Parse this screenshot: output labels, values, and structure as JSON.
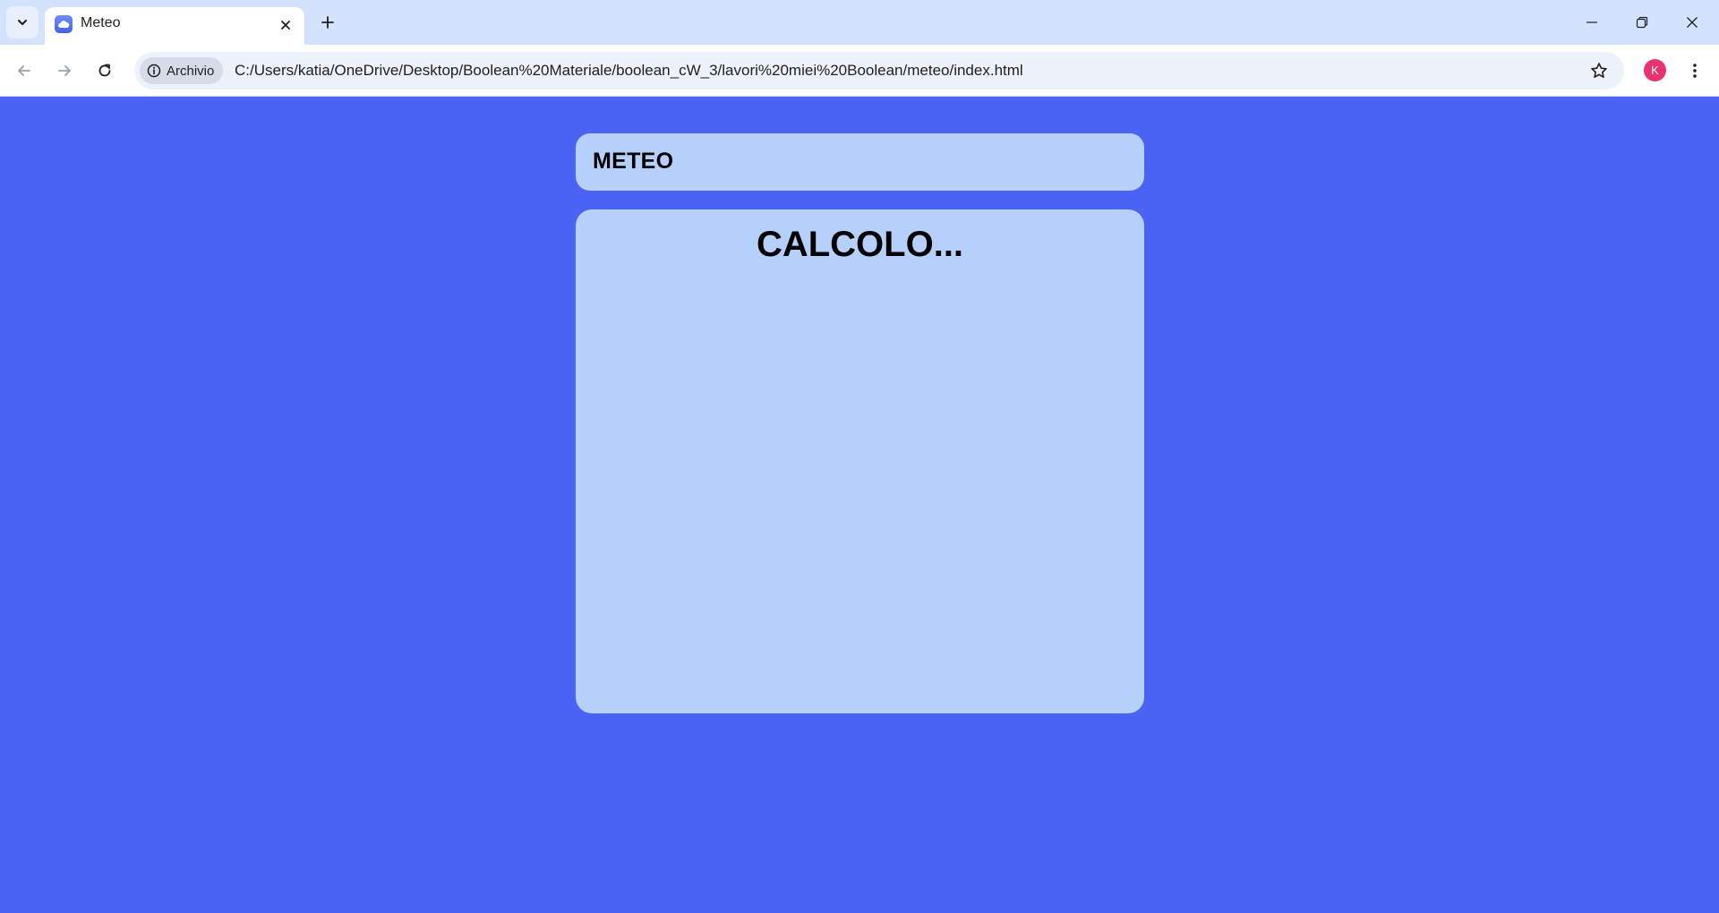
{
  "browser": {
    "tab": {
      "title": "Meteo",
      "favicon": "cloud-icon"
    },
    "address": {
      "security_label": "Archivio",
      "url": "C:/Users/katia/OneDrive/Desktop/Boolean%20Materiale/boolean_cW_3/lavori%20miei%20Boolean/meteo/index.html"
    },
    "profile_initial": "K",
    "colors": {
      "tabstrip": "#d3e3fd",
      "omnibox": "#edf2fa",
      "avatar": "#e8336f"
    }
  },
  "page": {
    "header_title": "METEO",
    "status": "CALCOLO...",
    "colors": {
      "background": "#4a63f2",
      "card": "#b6d0fc"
    }
  }
}
